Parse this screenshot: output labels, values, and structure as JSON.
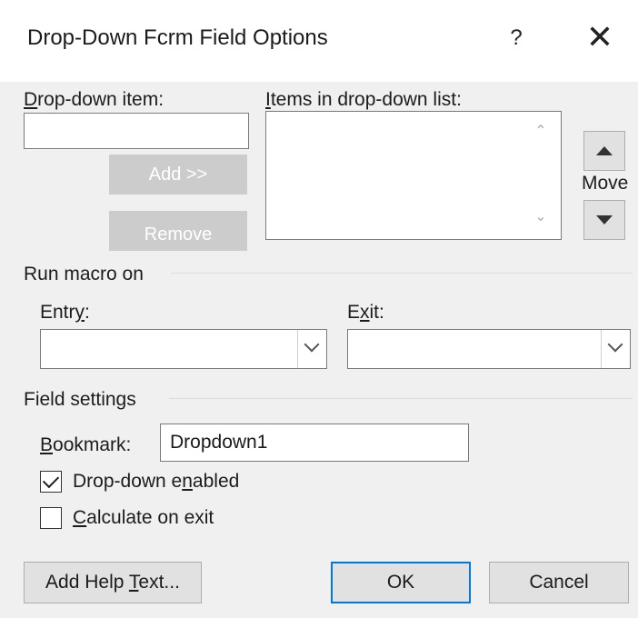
{
  "dialog": {
    "title": "Drop-Down Fcrm Field Options",
    "help_label": "?",
    "close_label": "✕"
  },
  "dropdown_item": {
    "label_prefix": "",
    "label_accel": "D",
    "label_rest": "rop-down item:",
    "value": ""
  },
  "items_list": {
    "label_accel": "I",
    "label_rest": "tems in drop-down list:",
    "items": []
  },
  "buttons": {
    "add": "Add >>",
    "remove": "Remove",
    "move": "Move",
    "add_help_text_prefix": "Add Help ",
    "add_help_text_accel": "T",
    "add_help_text_rest": "ext...",
    "ok": "OK",
    "cancel": "Cancel"
  },
  "run_macro": {
    "group_label": "Run macro on",
    "entry_prefix": "Entr",
    "entry_accel": "y",
    "entry_rest": ":",
    "entry_value": "",
    "exit_prefix": "E",
    "exit_accel": "x",
    "exit_rest": "it:",
    "exit_value": ""
  },
  "field_settings": {
    "group_label": "Field settings",
    "bookmark_accel": "B",
    "bookmark_rest": "ookmark:",
    "bookmark_value": "Dropdown1",
    "dropdown_enabled_prefix": "Drop-down e",
    "dropdown_enabled_accel": "n",
    "dropdown_enabled_rest": "abled",
    "dropdown_enabled_checked": true,
    "calculate_accel": "C",
    "calculate_rest": "alculate on exit",
    "calculate_checked": false
  },
  "colors": {
    "default_button_border": "#0078d7",
    "dialog_bg": "#f0f0f0",
    "disabled_button_bg": "#cccccc"
  }
}
